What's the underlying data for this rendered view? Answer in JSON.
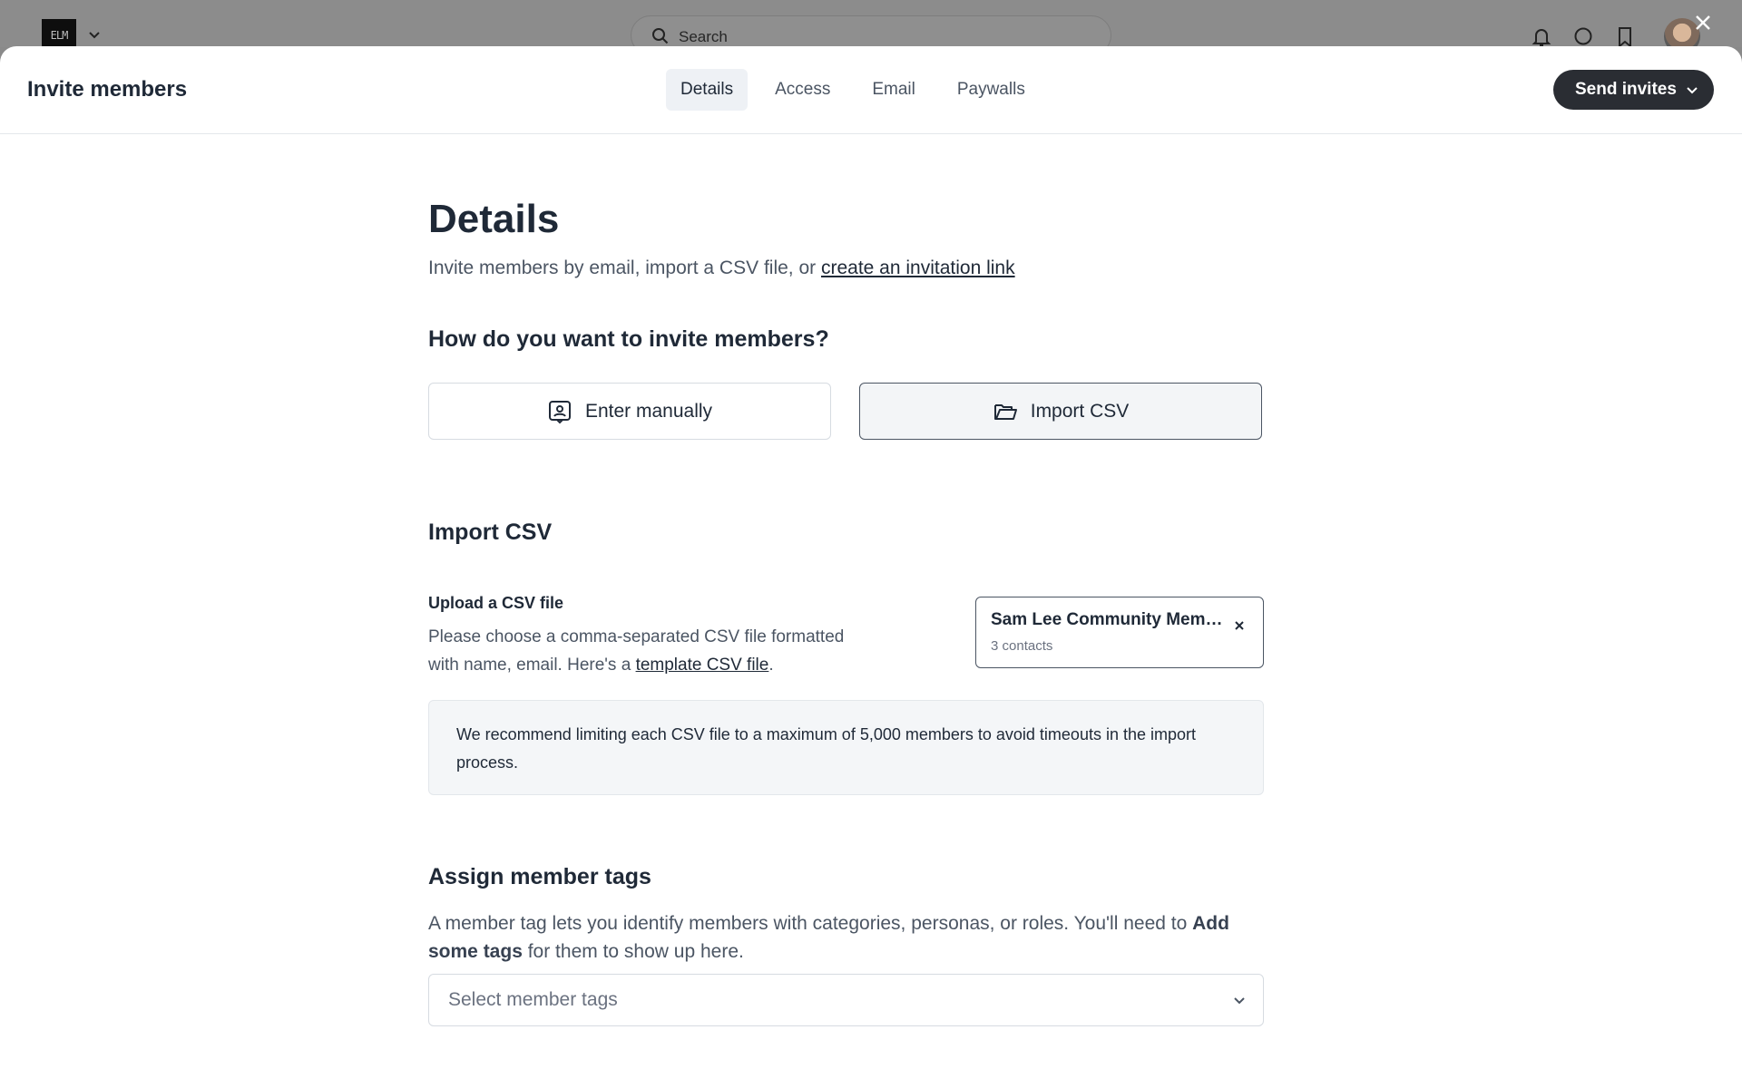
{
  "background": {
    "logo_text": "ELM",
    "search_placeholder": "Search"
  },
  "modal": {
    "title": "Invite members",
    "tabs": [
      {
        "label": "Details",
        "active": true
      },
      {
        "label": "Access",
        "active": false
      },
      {
        "label": "Email",
        "active": false
      },
      {
        "label": "Paywalls",
        "active": false
      }
    ],
    "send_label": "Send invites"
  },
  "details": {
    "heading": "Details",
    "intro_text": "Invite members by email, import a CSV file, or ",
    "intro_link": "create an invitation link"
  },
  "method": {
    "heading": "How do you want to invite members?",
    "options": [
      {
        "label": "Enter manually",
        "icon": "contact-card-icon",
        "selected": false
      },
      {
        "label": "Import CSV",
        "icon": "folder-open-icon",
        "selected": true
      }
    ]
  },
  "import_csv": {
    "heading": "Import CSV",
    "upload_label": "Upload a CSV file",
    "upload_desc_before": "Please choose a comma-separated CSV file formatted with name, email. Here's a ",
    "upload_link": "template CSV file",
    "upload_desc_after": ".",
    "file": {
      "name": "Sam Lee Community Members.csv",
      "contacts": "3 contacts"
    },
    "notice": "We recommend limiting each CSV file to a maximum of 5,000 members to avoid timeouts in the import process."
  },
  "tags": {
    "heading": "Assign member tags",
    "desc_before": "A member tag lets you identify members with categories, personas, or roles. You'll need to ",
    "desc_bold": "Add some tags",
    "desc_after": " for them to show up here.",
    "select_placeholder": "Select member tags"
  },
  "colors": {
    "primary_button": "#2a2d33",
    "active_tab_bg": "#eef1f5",
    "notice_bg": "#f4f6f8"
  }
}
